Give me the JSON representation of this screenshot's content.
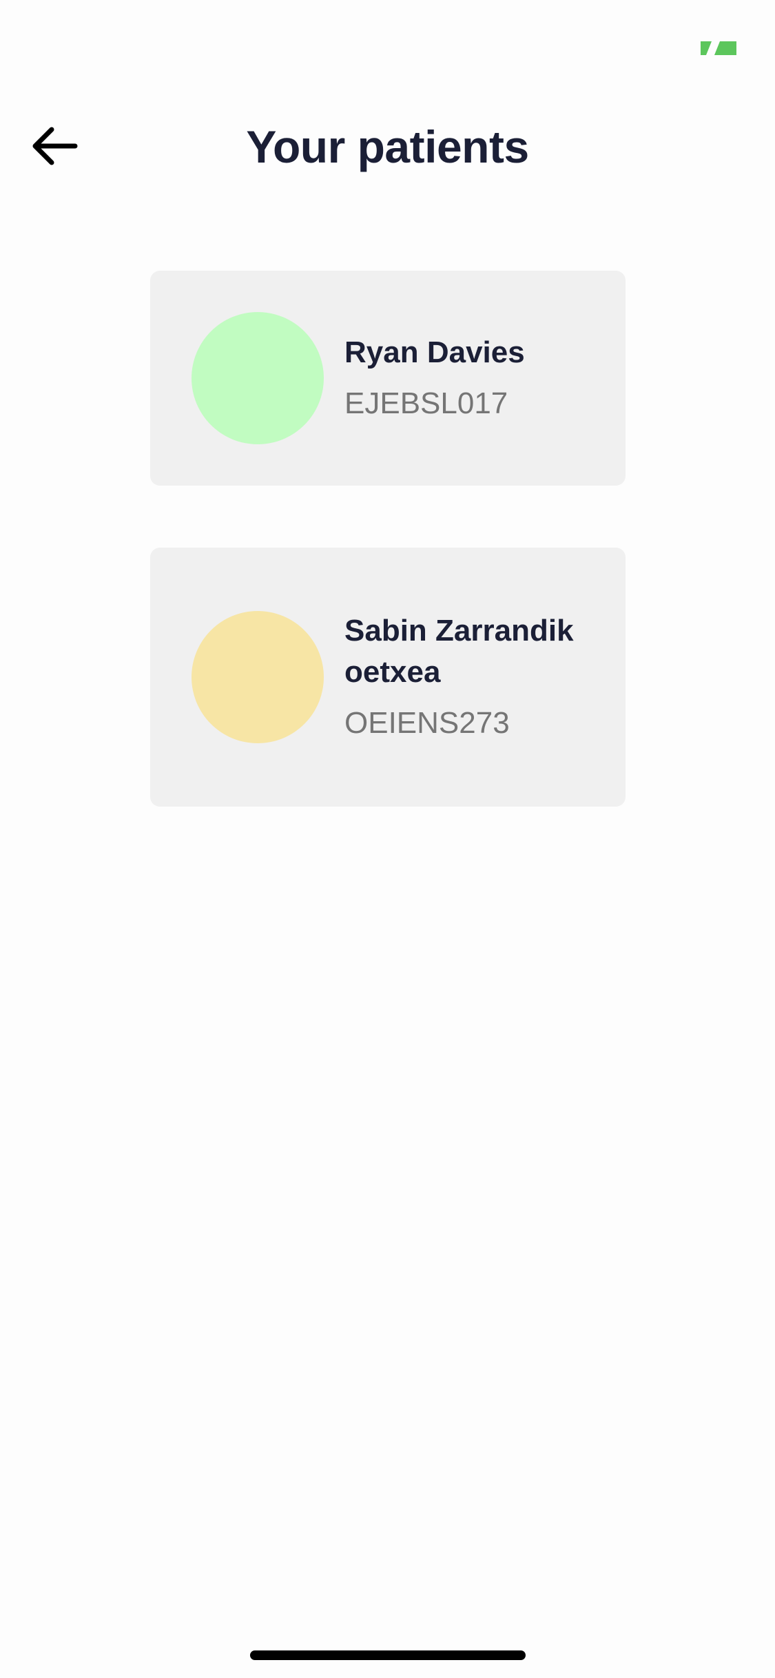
{
  "status_bar": {
    "battery_icon": "battery-charging-icon",
    "battery_color": "#5cc65c"
  },
  "header": {
    "back_icon": "arrow-left-icon",
    "title": "Your patients"
  },
  "patients": [
    {
      "name": "Ryan Davies",
      "code": "EJEBSL017",
      "avatar_color": "#c1fcc1"
    },
    {
      "name": "Sabin Zarrandikoetxea",
      "code": "OEIENS273",
      "avatar_color": "#f7e5a5"
    }
  ],
  "colors": {
    "background": "#fdfdfd",
    "card_background": "#f0f0f0",
    "title_text": "#1b1f36",
    "secondary_text": "#757575"
  }
}
